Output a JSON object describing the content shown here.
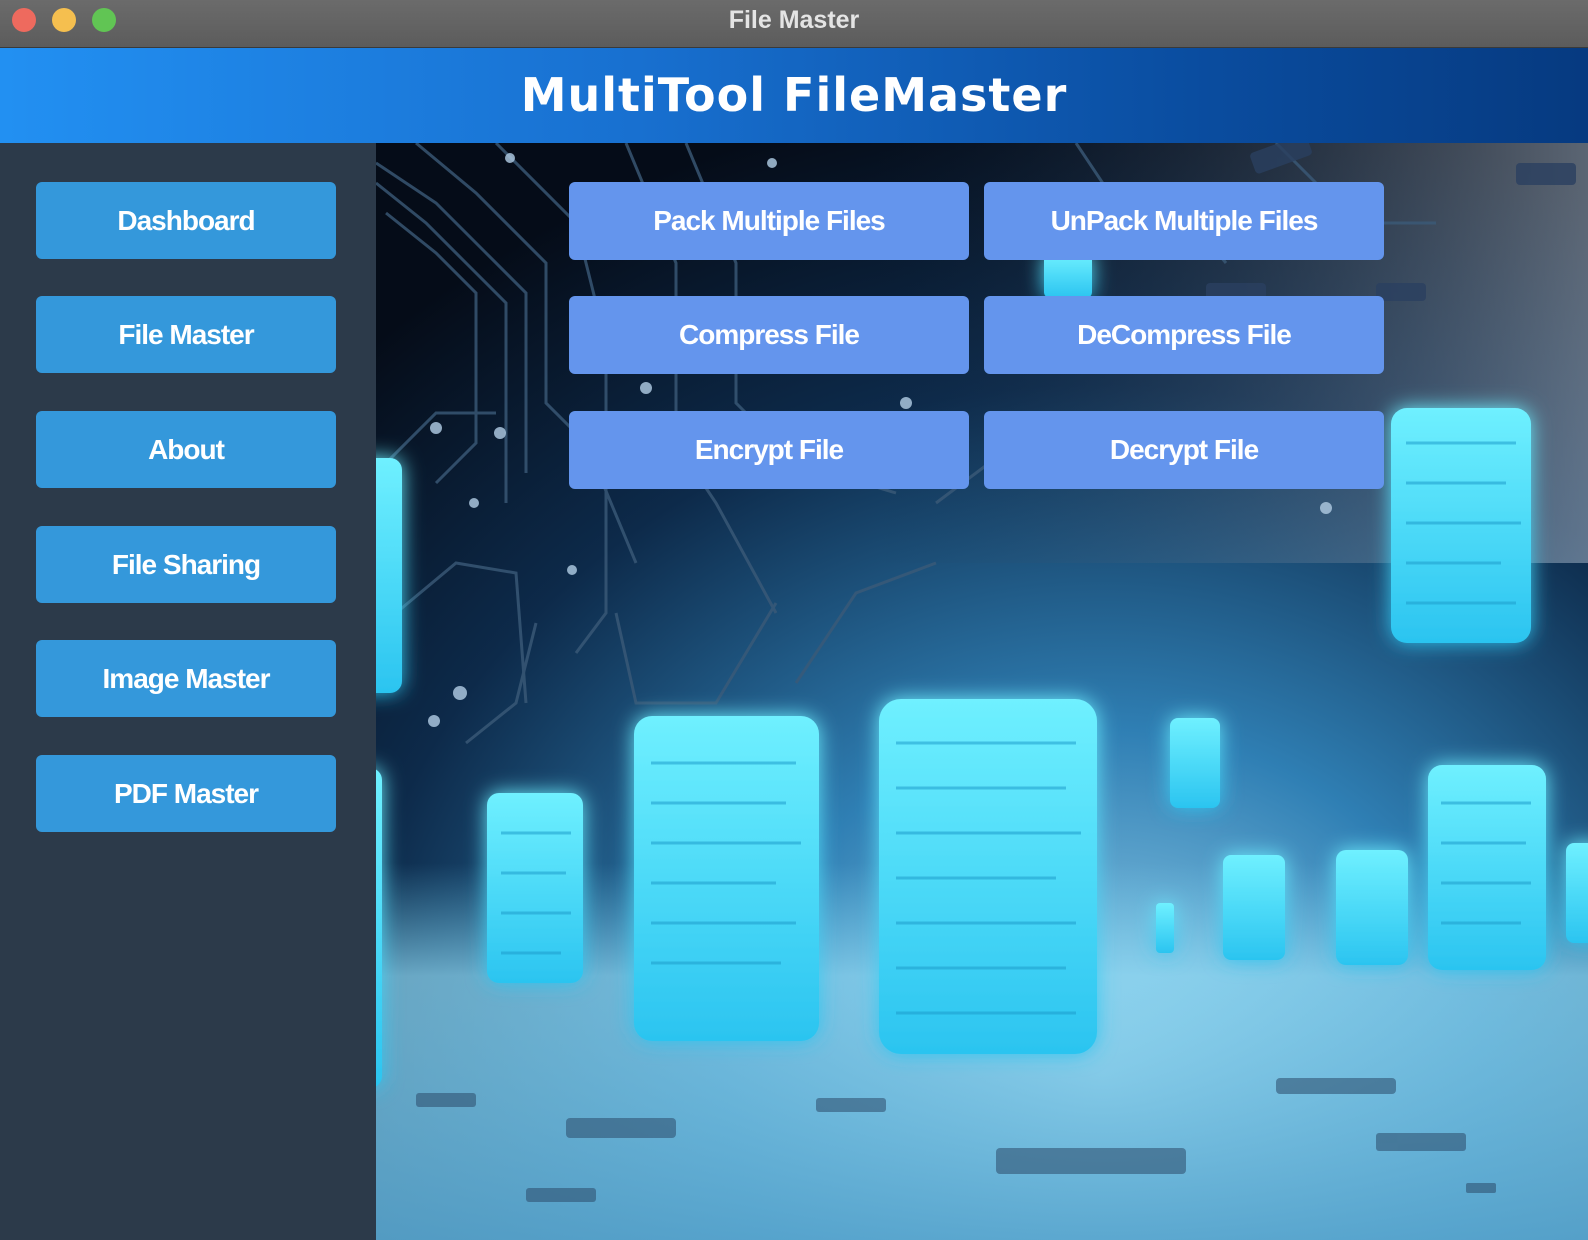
{
  "window": {
    "title": "File Master"
  },
  "header": {
    "title": "MultiTool FileMaster"
  },
  "sidebar": {
    "items": [
      {
        "label": "Dashboard"
      },
      {
        "label": "File Master"
      },
      {
        "label": "About"
      },
      {
        "label": "File Sharing"
      },
      {
        "label": "Image Master"
      },
      {
        "label": "PDF Master"
      }
    ]
  },
  "actions": {
    "pack": "Pack Multiple Files",
    "unpack": "UnPack Multiple Files",
    "compress": "Compress File",
    "decompress": "DeCompress File",
    "encrypt": "Encrypt File",
    "decrypt": "Decrypt File"
  },
  "colors": {
    "sidebar_bg": "#2c3a4a",
    "sidebar_button": "#3498db",
    "action_button": "#6495ed",
    "header_gradient_start": "#2290f2",
    "header_gradient_end": "#063a80"
  },
  "icons": {
    "close": "close-icon",
    "minimize": "minimize-icon",
    "maximize": "maximize-icon",
    "background": "floating-files-illustration"
  }
}
